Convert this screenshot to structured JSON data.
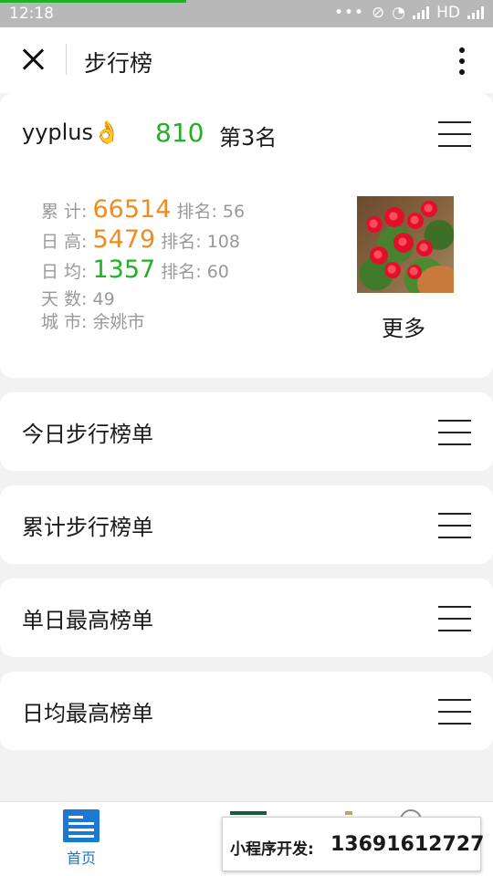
{
  "status_bar": {
    "time": "12:18",
    "network": "HD",
    "icons": [
      "more-dots-icon",
      "wifi-icon",
      "signal-icon",
      "signal-icon"
    ]
  },
  "nav": {
    "title": "步行榜"
  },
  "profile": {
    "username": "yyplus👌",
    "today_steps": "810",
    "rank": "第3名",
    "stats": [
      {
        "label": "累 计:",
        "value": "66514",
        "value_color": "#f08b1d",
        "rank_label": "排名:",
        "rank_value": "56"
      },
      {
        "label": "日 高:",
        "value": "5479",
        "value_color": "#f08b1d",
        "rank_label": "排名:",
        "rank_value": "108"
      },
      {
        "label": "日 均:",
        "value": "1357",
        "value_color": "#22b025",
        "rank_label": "排名:",
        "rank_value": "60"
      }
    ],
    "days": {
      "label": "天 数:",
      "value": "49"
    },
    "city": {
      "label": "城 市:",
      "value": "余姚市"
    },
    "more_label": "更多"
  },
  "lists": [
    {
      "label": "今日步行榜单"
    },
    {
      "label": "累计步行榜单"
    },
    {
      "label": "单日最高榜单"
    },
    {
      "label": "日均最高榜单"
    }
  ],
  "tabbar": {
    "home_label": "首页"
  },
  "ad": {
    "label": "小程序开发:",
    "phone": "13691612727"
  }
}
